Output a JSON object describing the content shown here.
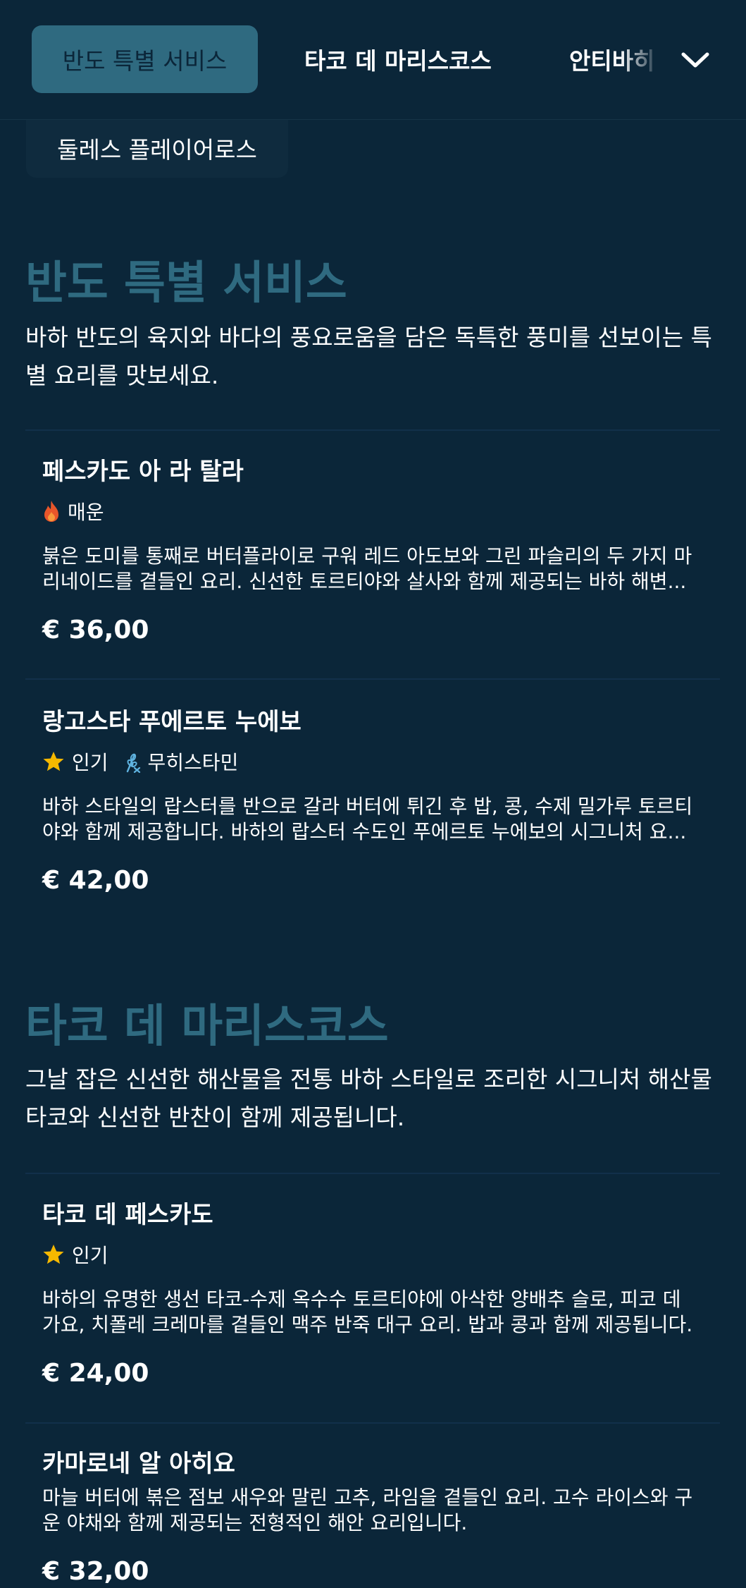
{
  "nav": {
    "tabs": [
      {
        "label": "반도 특별 서비스"
      },
      {
        "label": "타코 데 마리스코스"
      },
      {
        "label": "안티바히"
      }
    ],
    "overflow_tab": "둘레스 플레이어로스"
  },
  "sections": [
    {
      "title": "반도 특별 서비스",
      "description": "바하 반도의 육지와 바다의 풍요로움을 담은 독특한 풍미를 선보이는 특별 요리를 맛보세요.",
      "items": [
        {
          "name": "페스카도 아 라 탈라",
          "tags": [
            {
              "icon": "fire-icon",
              "label": "매운"
            }
          ],
          "description": "붉은 도미를 통째로 버터플라이로 구워 레드 아도보와 그린 파슬리의 두 가지 마리네이드를 곁들인 요리. 신선한 토르티야와 살사와 함께 제공되는 바하 해변...",
          "price": "€ 36,00"
        },
        {
          "name": "랑고스타 푸에르토 누에보",
          "tags": [
            {
              "icon": "star-icon",
              "label": "인기"
            },
            {
              "icon": "gluten-free-icon",
              "label": "무히스타민"
            }
          ],
          "description": "바하 스타일의 랍스터를 반으로 갈라 버터에 튀긴 후 밥, 콩, 수제 밀가루 토르티야와 함께 제공합니다. 바하의 랍스터 수도인 푸에르토 누에보의 시그니처 요...",
          "price": "€ 42,00"
        }
      ]
    },
    {
      "title": "타코 데 마리스코스",
      "description": "그날 잡은 신선한 해산물을 전통 바하 스타일로 조리한 시그니처 해산물 타코와 신선한 반찬이 함께 제공됩니다.",
      "items": [
        {
          "name": "타코 데 페스카도",
          "tags": [
            {
              "icon": "star-icon",
              "label": "인기"
            }
          ],
          "description": "바하의 유명한 생선 타코-수제 옥수수 토르티야에 아삭한 양배추 슬로, 피코 데 가요, 치폴레 크레마를 곁들인 맥주 반죽 대구 요리. 밥과 콩과 함께 제공됩니다.",
          "price": "€ 24,00"
        },
        {
          "name": "카마로네 알 아히요",
          "tags": [],
          "description": "마늘 버터에 볶은 점보 새우와 말린 고추, 라임을 곁들인 요리. 고수 라이스와 구운 야채와 함께 제공되는 전형적인 해안 요리입니다.",
          "price": "€ 32,00"
        }
      ]
    }
  ],
  "colors": {
    "background": "#0b2639",
    "accent": "#2f6a80",
    "fire": "#e8562a",
    "star": "#f5b800",
    "gluten": "#5fb3e0"
  }
}
